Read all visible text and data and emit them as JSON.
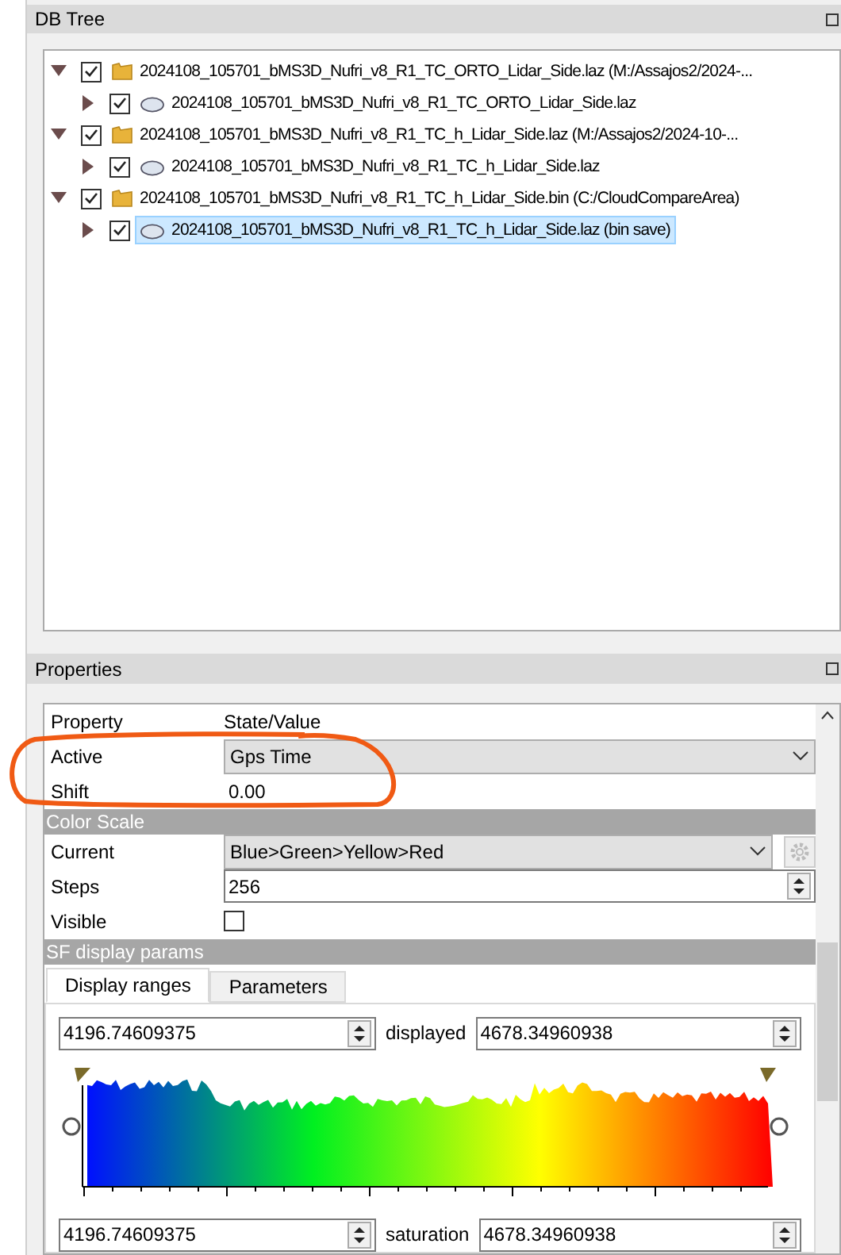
{
  "db_tree": {
    "title": "DB Tree",
    "items": [
      {
        "label": "2024108_105701_bMS3D_Nufri_v8_R1_TC_ORTO_Lidar_Side.laz (M:/Assajos2/2024-...",
        "kind": "folder",
        "checked": true,
        "expanded": true,
        "selected": false,
        "children": [
          {
            "label": "2024108_105701_bMS3D_Nufri_v8_R1_TC_ORTO_Lidar_Side.laz",
            "kind": "cloud",
            "checked": true,
            "expanded": false,
            "selected": false
          }
        ]
      },
      {
        "label": "2024108_105701_bMS3D_Nufri_v8_R1_TC_h_Lidar_Side.laz (M:/Assajos2/2024-10-...",
        "kind": "folder",
        "checked": true,
        "expanded": true,
        "selected": false,
        "children": [
          {
            "label": "2024108_105701_bMS3D_Nufri_v8_R1_TC_h_Lidar_Side.laz",
            "kind": "cloud",
            "checked": true,
            "expanded": false,
            "selected": false
          }
        ]
      },
      {
        "label": "2024108_105701_bMS3D_Nufri_v8_R1_TC_h_Lidar_Side.bin (C:/CloudCompareArea)",
        "kind": "folder",
        "checked": true,
        "expanded": true,
        "selected": false,
        "children": [
          {
            "label": "2024108_105701_bMS3D_Nufri_v8_R1_TC_h_Lidar_Side.laz (bin save)",
            "kind": "cloud",
            "checked": true,
            "expanded": false,
            "selected": true
          }
        ]
      }
    ]
  },
  "properties": {
    "title": "Properties",
    "columns": [
      "Property",
      "State/Value"
    ],
    "rows": [
      {
        "kind": "dropdown",
        "name": "Active",
        "value": "Gps Time"
      },
      {
        "kind": "text",
        "name": "Shift",
        "value": "0.00"
      },
      {
        "kind": "section",
        "name": "Color Scale"
      },
      {
        "kind": "dropdown_gear",
        "name": "Current",
        "value": "Blue>Green>Yellow>Red"
      },
      {
        "kind": "spin",
        "name": "Steps",
        "value": "256"
      },
      {
        "kind": "checkbox",
        "name": "Visible",
        "checked": false
      },
      {
        "kind": "section",
        "name": "SF display params"
      }
    ],
    "tabs": [
      {
        "label": "Display ranges",
        "selected": true
      },
      {
        "label": "Parameters",
        "selected": false
      }
    ],
    "displayed": {
      "min": "4196.74609375",
      "label": "displayed",
      "max": "4678.34960938"
    },
    "saturation": {
      "min": "4196.74609375",
      "label": "saturation",
      "max": "4678.34960938"
    }
  }
}
